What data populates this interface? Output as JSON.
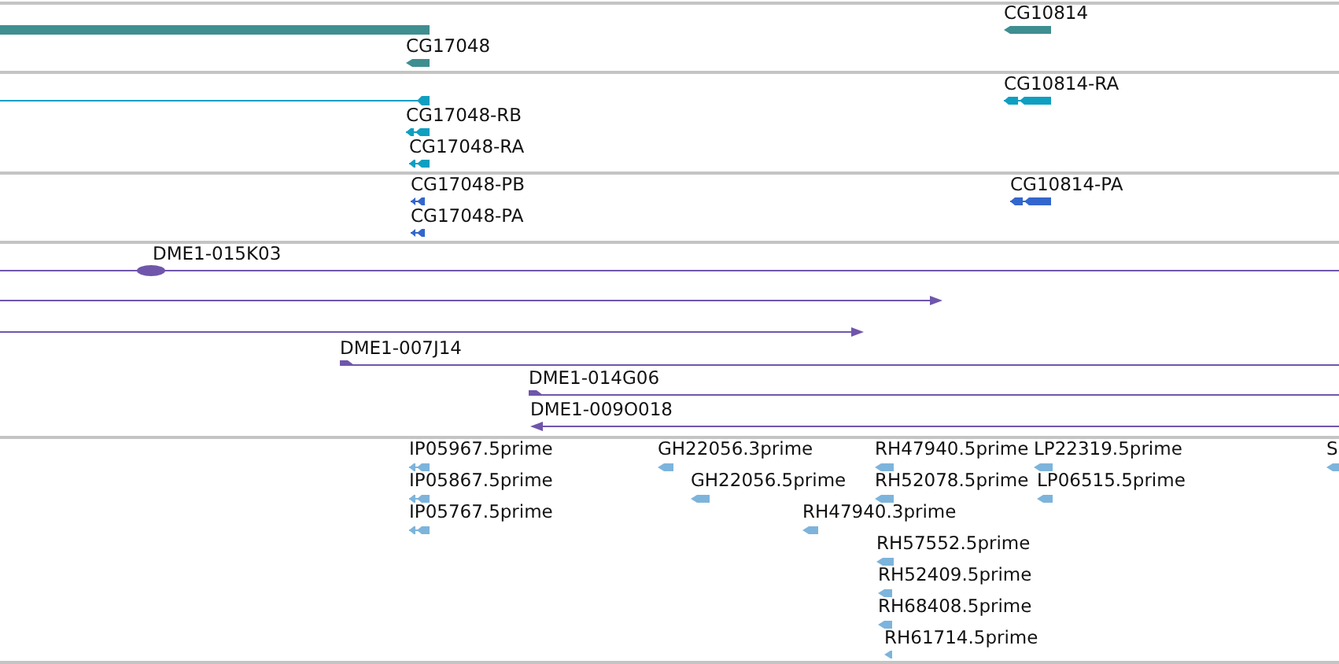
{
  "tracks": [
    {
      "color": "#3f8e90",
      "features": [
        {
          "kind": "block"
        },
        {
          "kind": "arrow-block",
          "label": "CG17048"
        },
        {
          "kind": "arrow-block",
          "label": "CG10814"
        }
      ]
    },
    {
      "color": "#0f9fc1",
      "features": [
        {
          "kind": "line-end-block"
        },
        {
          "kind": "exons",
          "label": "CG17048-RB"
        },
        {
          "kind": "exons",
          "label": "CG17048-RA"
        },
        {
          "kind": "exons",
          "label": "CG10814-RA"
        }
      ]
    },
    {
      "color": "#3366cc",
      "features": [
        {
          "kind": "exons",
          "label": "CG17048-PB"
        },
        {
          "kind": "exons",
          "label": "CG17048-PA"
        },
        {
          "kind": "exons",
          "label": "CG10814-PA"
        }
      ]
    },
    {
      "color": "#6f56ab",
      "features": [
        {
          "kind": "line-oval",
          "label": "DME1-015K03"
        },
        {
          "kind": "line-right"
        },
        {
          "kind": "line-right"
        },
        {
          "kind": "line-start-right",
          "label": "DME1-007J14"
        },
        {
          "kind": "line-start-right",
          "label": "DME1-014G06"
        },
        {
          "kind": "line-left",
          "label": "DME1-009O018"
        }
      ]
    },
    {
      "color": "#7db4dc",
      "features": [
        {
          "kind": "exons",
          "label": "IP05967.5prime"
        },
        {
          "kind": "exons",
          "label": "IP05867.5prime"
        },
        {
          "kind": "exons",
          "label": "IP05767.5prime"
        },
        {
          "kind": "arrow-block",
          "label": "GH22056.3prime"
        },
        {
          "kind": "arrow-block",
          "label": "GH22056.5prime"
        },
        {
          "kind": "arrow-block",
          "label": "RH47940.5prime"
        },
        {
          "kind": "arrow-block",
          "label": "LP22319.5prime"
        },
        {
          "kind": "arrow-block",
          "label": "S"
        },
        {
          "kind": "arrow-block",
          "label": "RH52078.5prime"
        },
        {
          "kind": "arrow-block",
          "label": "LP06515.5prime"
        },
        {
          "kind": "arrow-block",
          "label": "RH47940.3prime"
        },
        {
          "kind": "arrow-block",
          "label": "RH57552.5prime"
        },
        {
          "kind": "arrow-block",
          "label": "RH52409.5prime"
        },
        {
          "kind": "arrow-block",
          "label": "RH68408.5prime"
        },
        {
          "kind": "arrow-block",
          "label": "RH61714.5prime"
        }
      ]
    }
  ]
}
